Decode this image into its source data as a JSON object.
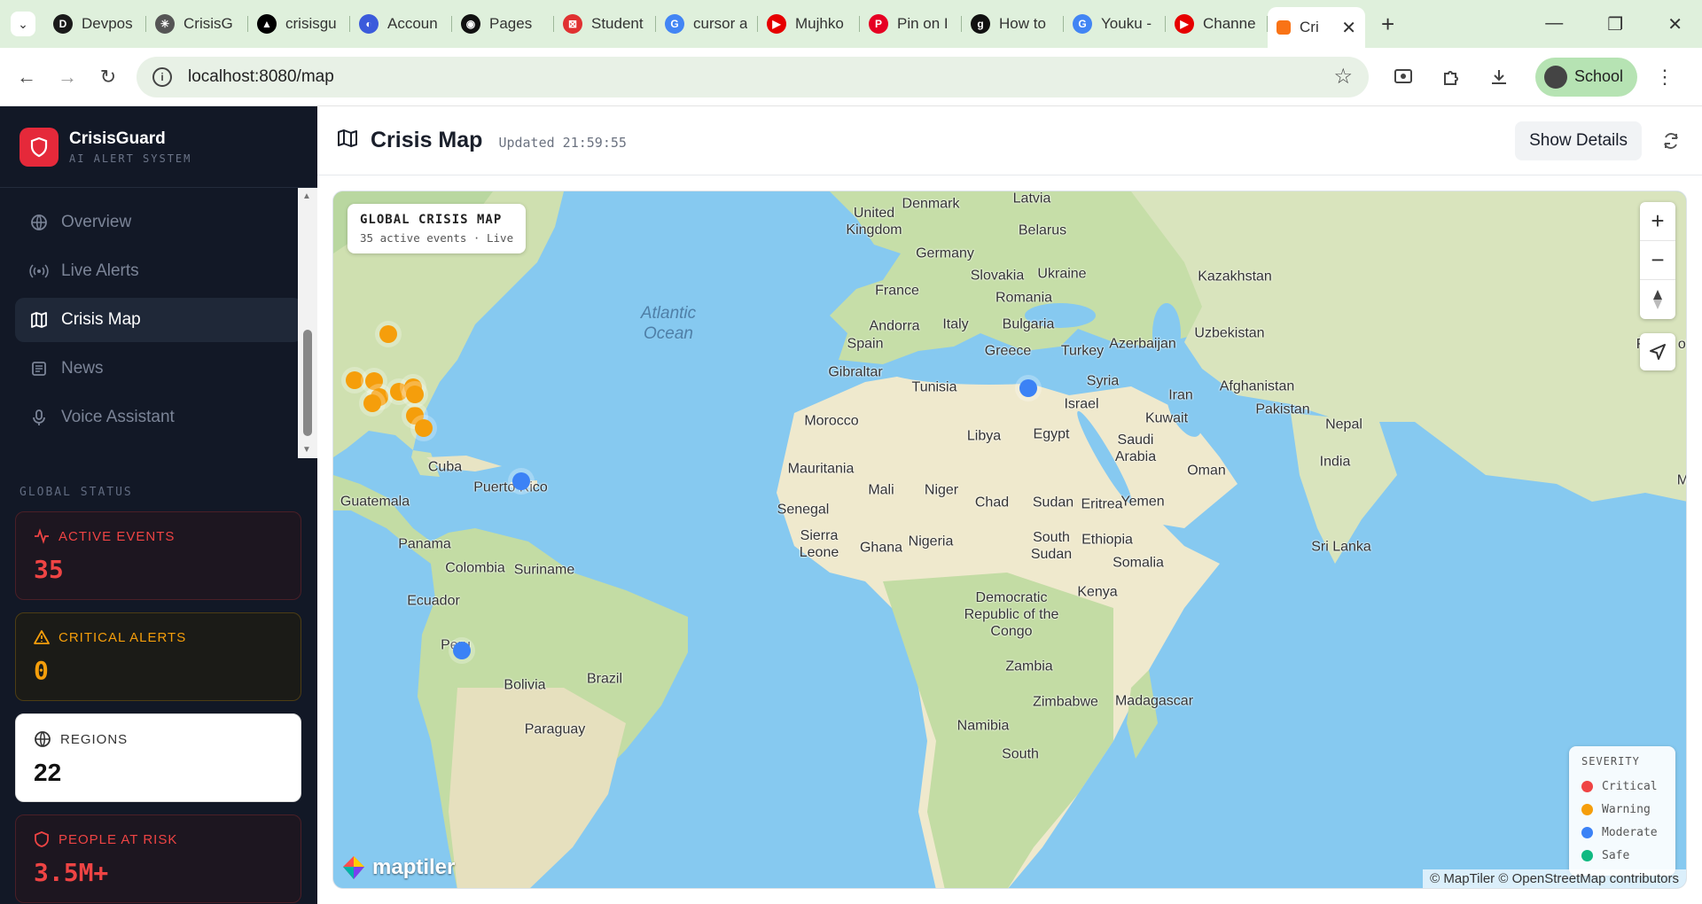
{
  "browser": {
    "tabs": [
      {
        "label": "Devpos",
        "icon": "devpost-icon",
        "color": "#1a1a1a",
        "glyph": "D"
      },
      {
        "label": "CrisisG",
        "icon": "openai-icon",
        "color": "#555",
        "glyph": "✳"
      },
      {
        "label": "crisisgu",
        "icon": "vercel-icon",
        "color": "#000",
        "glyph": "▲"
      },
      {
        "label": "Accoun",
        "icon": "account-icon",
        "color": "#3b5bdb",
        "glyph": "◐"
      },
      {
        "label": "Pages",
        "icon": "github-icon",
        "color": "#111",
        "glyph": "◉"
      },
      {
        "label": "Student",
        "icon": "student-icon",
        "color": "#e03131",
        "glyph": "⊠"
      },
      {
        "label": "cursor a",
        "icon": "google-icon",
        "color": "#4285f4",
        "glyph": "G"
      },
      {
        "label": "Mujhko",
        "icon": "youtube-icon",
        "color": "#e60000",
        "glyph": "▶"
      },
      {
        "label": "Pin on I",
        "icon": "pinterest-icon",
        "color": "#e60023",
        "glyph": "P"
      },
      {
        "label": "How to",
        "icon": "genius-icon",
        "color": "#111",
        "glyph": "g"
      },
      {
        "label": "Youku -",
        "icon": "google-icon",
        "color": "#4285f4",
        "glyph": "G"
      },
      {
        "label": "Channe",
        "icon": "youtube-icon",
        "color": "#e60000",
        "glyph": "▶"
      }
    ],
    "active_tab": {
      "label": "Cri",
      "icon": "crisisguard-tab-icon"
    },
    "url": "localhost:8080/map",
    "profile_label": "School"
  },
  "sidebar": {
    "brand_name": "CrisisGuard",
    "brand_sub": "AI ALERT SYSTEM",
    "nav": [
      {
        "label": "Overview",
        "icon": "globe-icon",
        "active": false
      },
      {
        "label": "Live Alerts",
        "icon": "broadcast-icon",
        "active": false
      },
      {
        "label": "Crisis Map",
        "icon": "map-icon",
        "active": true
      },
      {
        "label": "News",
        "icon": "newspaper-icon",
        "active": false
      },
      {
        "label": "Voice Assistant",
        "icon": "mic-icon",
        "active": false
      }
    ],
    "status_title": "GLOBAL STATUS",
    "cards": [
      {
        "title": "ACTIVE EVENTS",
        "value": "35",
        "icon": "activity-icon"
      },
      {
        "title": "CRITICAL ALERTS",
        "value": "0",
        "icon": "warning-icon"
      },
      {
        "title": "REGIONS",
        "value": "22",
        "icon": "globe-icon"
      },
      {
        "title": "PEOPLE AT RISK",
        "value": "3.5M+",
        "icon": "shield-icon"
      }
    ]
  },
  "main": {
    "title": "Crisis Map",
    "updated": "Updated 21:59:55",
    "details_button": "Show Details"
  },
  "map": {
    "overlay_title": "GLOBAL CRISIS MAP",
    "overlay_sub": "35 active events · Live",
    "places": [
      "Denmark",
      "Latvia",
      "United Kingdom",
      "Belarus",
      "Germany",
      "Slovakia",
      "Ukraine",
      "Kazakhstan",
      "France",
      "Romania",
      "Andorra",
      "Italy",
      "Bulgaria",
      "Uzbekistan",
      "Spain",
      "Greece",
      "Turkey",
      "Azerbaijan",
      "Gibraltar",
      "Syria",
      "Tunisia",
      "Israel",
      "Afghanistan",
      "Iran",
      "Morocco",
      "Libya",
      "Egypt",
      "Kuwait",
      "Pakistan",
      "Nepal",
      "Saudi Arabia",
      "Oman",
      "India",
      "Mauritania",
      "Mali",
      "Niger",
      "Chad",
      "Sudan",
      "Eritrea",
      "Yemen",
      "Senegal",
      "Sierra Leone",
      "Ghana",
      "Nigeria",
      "South Sudan",
      "Ethiopia",
      "Somalia",
      "Sri Lanka",
      "Kenya",
      "Democratic Republic of the Congo",
      "Zambia",
      "Madagascar",
      "Zimbabwe",
      "Namibia",
      "South",
      "Cuba",
      "Puerto Rico",
      "Guatemala",
      "Panama",
      "Colombia",
      "Suriname",
      "Ecuador",
      "Peru",
      "Brazil",
      "Bolivia",
      "Paraguay",
      "Atlantic Ocean",
      "Myanm",
      "Reput of Chi"
    ],
    "events": [
      {
        "severity": "warning"
      },
      {
        "severity": "warning"
      },
      {
        "severity": "warning"
      },
      {
        "severity": "warning"
      },
      {
        "severity": "warning"
      },
      {
        "severity": "warning"
      },
      {
        "severity": "warning"
      },
      {
        "severity": "warning"
      },
      {
        "severity": "warning"
      },
      {
        "severity": "warning"
      },
      {
        "severity": "moderate"
      },
      {
        "severity": "moderate"
      },
      {
        "severity": "moderate"
      }
    ],
    "severity_title": "SEVERITY",
    "severity_legend": [
      {
        "label": "Critical",
        "color": "#ef4444"
      },
      {
        "label": "Warning",
        "color": "#f59e0b"
      },
      {
        "label": "Moderate",
        "color": "#3b82f6"
      },
      {
        "label": "Safe",
        "color": "#10b981"
      }
    ],
    "brand": "maptiler",
    "attribution": "© MapTiler © OpenStreetMap contributors"
  }
}
